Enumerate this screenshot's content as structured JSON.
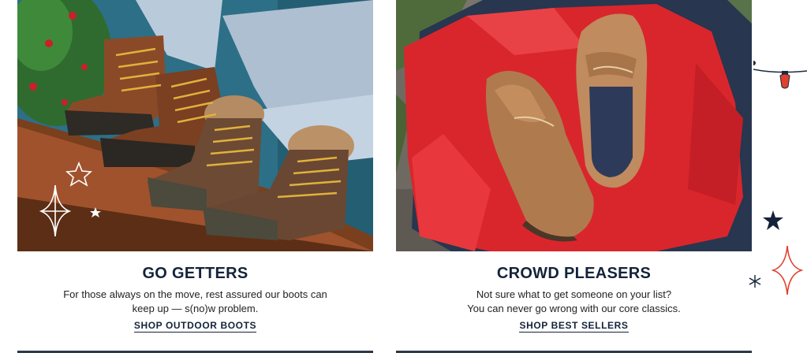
{
  "cards": [
    {
      "title": "GO GETTERS",
      "desc_line1": "For those always on the move, rest assured our boots can",
      "desc_line2": "keep up — s(no)w problem.",
      "link": "SHOP OUTDOOR BOOTS",
      "image_alt": "boots-photo"
    },
    {
      "title": "CROWD PLEASERS",
      "desc_line1": "Not sure what to get someone on your list?",
      "desc_line2": "You can never go wrong with our core classics.",
      "link": "SHOP BEST SELLERS",
      "image_alt": "boat-shoes-gift-photo"
    }
  ],
  "colors": {
    "navy": "#14233a",
    "accent_red": "#e0412f",
    "teal": "#2d6f86",
    "gift_red": "#d9262c"
  },
  "decorations": [
    "star-icon",
    "sparkle-icon",
    "string-light-icon",
    "snowflake-icon"
  ]
}
